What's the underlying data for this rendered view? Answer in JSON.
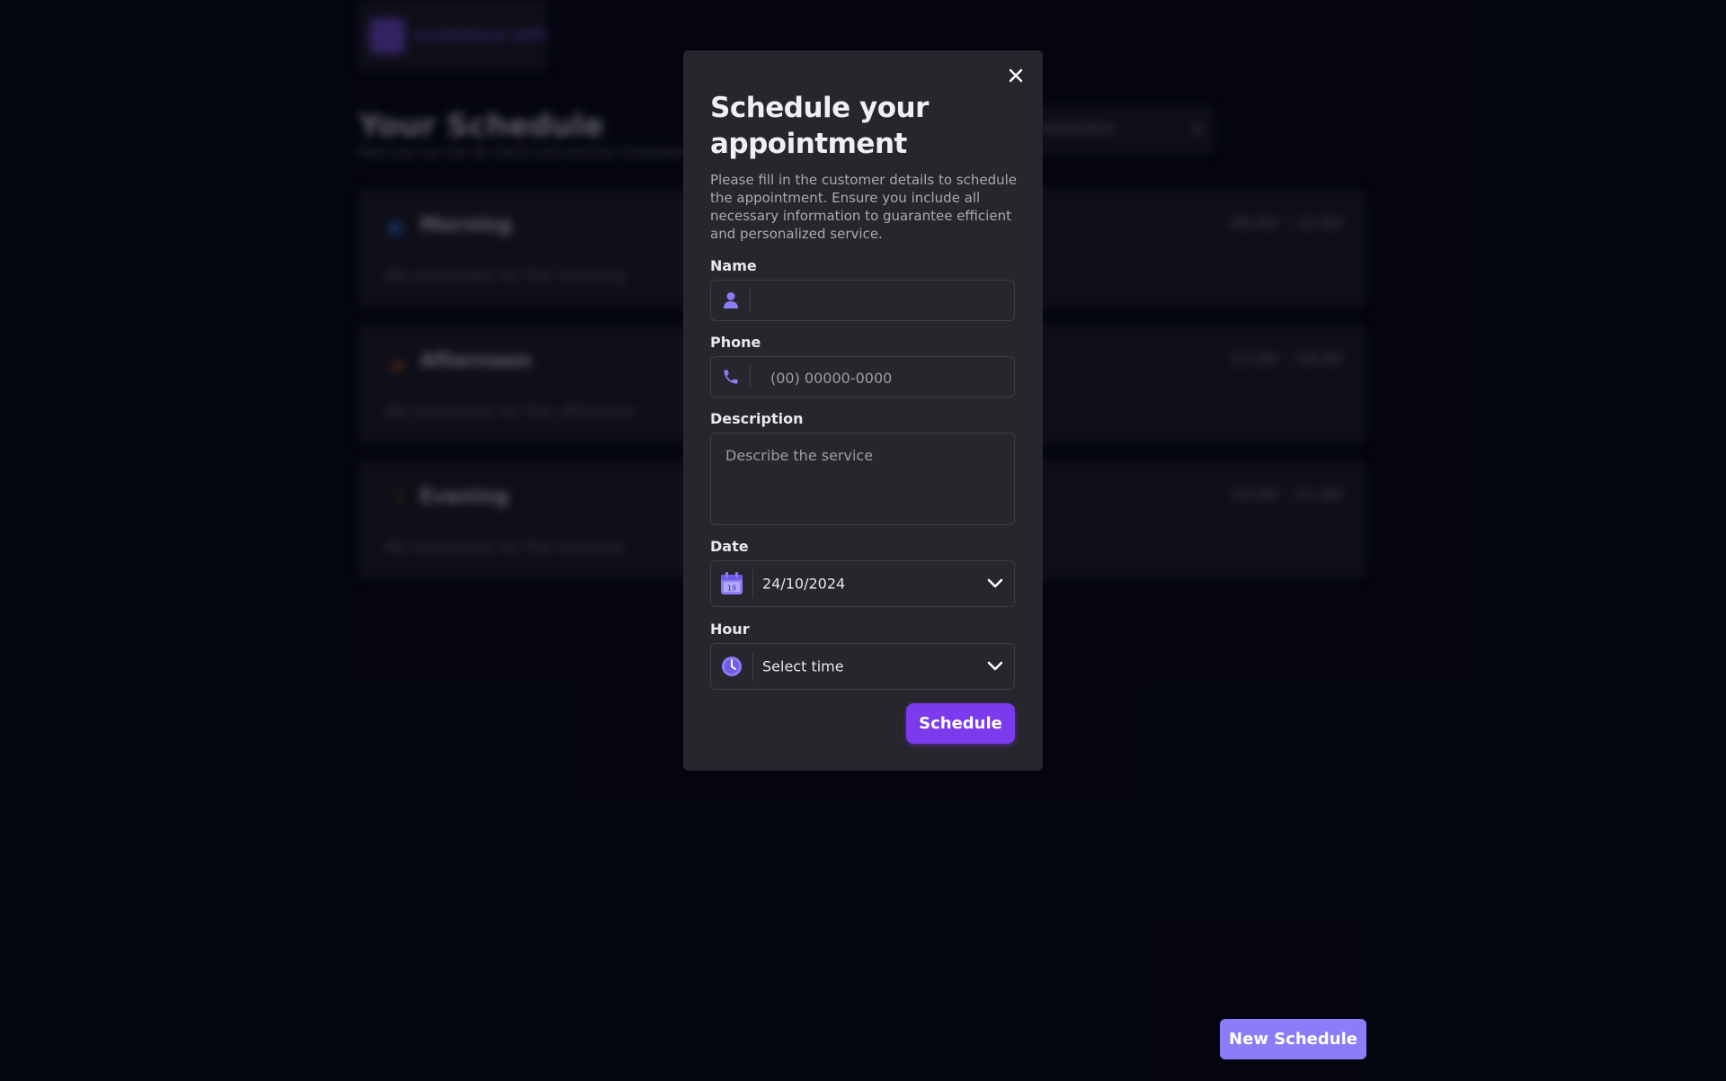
{
  "background": {
    "app_name": "SCHEDULE APP",
    "title": "Your Schedule",
    "subtitle": "Here you can see all clients and services scheduled for today.",
    "date_filter": "24/10/2024",
    "periods": [
      {
        "name": "Morning",
        "range": "09:00 – 12:00",
        "empty": "No schedules for the morning",
        "icon": "sun-icon",
        "color": "#3b82f6"
      },
      {
        "name": "Afternoon",
        "range": "13:00 – 18:00",
        "empty": "No schedules for the afternoon",
        "icon": "cloud-sun-icon",
        "color": "#f97316"
      },
      {
        "name": "Evening",
        "range": "19:00 – 21:00",
        "empty": "No schedules for the evening",
        "icon": "moon-icon",
        "color": "#eab308"
      }
    ],
    "new_schedule_label": "New Schedule"
  },
  "modal": {
    "title": "Schedule your appointment",
    "description": "Please fill in the customer details to schedule the appointment. Ensure you include all necessary information to guarantee efficient and personalized service.",
    "name": {
      "label": "Name",
      "value": "",
      "placeholder": "",
      "icon": "user-icon"
    },
    "phone": {
      "label": "Phone",
      "value": "",
      "placeholder": "(00) 00000-0000",
      "icon": "phone-icon"
    },
    "description_field": {
      "label": "Description",
      "value": "",
      "placeholder": "Describe the service"
    },
    "date": {
      "label": "Date",
      "value": "24/10/2024",
      "icon": "calendar-icon",
      "calendar_day": "19"
    },
    "hour": {
      "label": "Hour",
      "value": "Select time",
      "icon": "clock-icon"
    },
    "submit_label": "Schedule"
  },
  "colors": {
    "accent": "#8b5cf6",
    "button": "#7c3aed",
    "new_schedule_button": "#8b7cf8",
    "modal_bg": "#26262c",
    "page_bg": "#050713"
  }
}
